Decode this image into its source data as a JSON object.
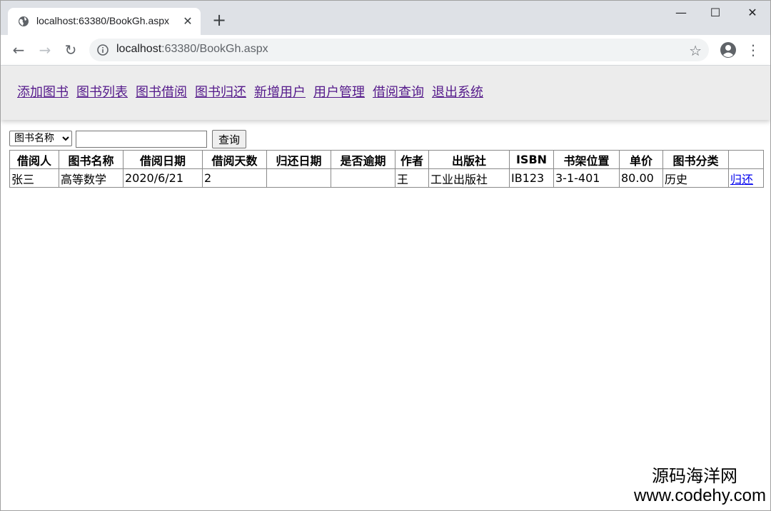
{
  "browser": {
    "tab_title": "localhost:63380/BookGh.aspx",
    "url_host": "localhost",
    "url_rest": ":63380/BookGh.aspx",
    "icons": {
      "favicon": "globe-icon",
      "tab_close": "close-icon",
      "new_tab": "plus-icon",
      "back": "back-arrow-icon",
      "forward": "forward-arrow-icon",
      "reload": "reload-icon",
      "site_info": "info-icon",
      "bookmark": "star-icon",
      "profile": "account-icon",
      "menu": "more-vert-icon",
      "minimize": "minimize-icon",
      "maximize": "maximize-icon",
      "close_window": "close-window-icon"
    }
  },
  "nav": {
    "items": [
      "添加图书",
      "图书列表",
      "图书借阅",
      "图书归还",
      "新增用户",
      "用户管理",
      "借阅查询",
      "退出系统"
    ]
  },
  "search": {
    "select_value": "图书名称",
    "input_value": "",
    "button_label": "查询"
  },
  "table": {
    "headers": [
      "借阅人",
      "图书名称",
      "借阅日期",
      "借阅天数",
      "归还日期",
      "是否逾期",
      "作者",
      "出版社",
      "ISBN",
      "书架位置",
      "单价",
      "图书分类",
      ""
    ],
    "rows": [
      {
        "cells": [
          "张三",
          "高等数学",
          "2020/6/21",
          "2",
          "",
          "",
          "王",
          "工业出版社",
          "IB123",
          "3-1-401",
          "80.00",
          "历史"
        ],
        "action": "归还"
      }
    ]
  },
  "watermark": {
    "line1": "源码海洋网",
    "line2": "www.codehy.com"
  },
  "colors": {
    "tabstrip": "#dee1e6",
    "navbar_bg": "#ececec",
    "visited_link": "#551a8b",
    "link": "#0000ee"
  }
}
